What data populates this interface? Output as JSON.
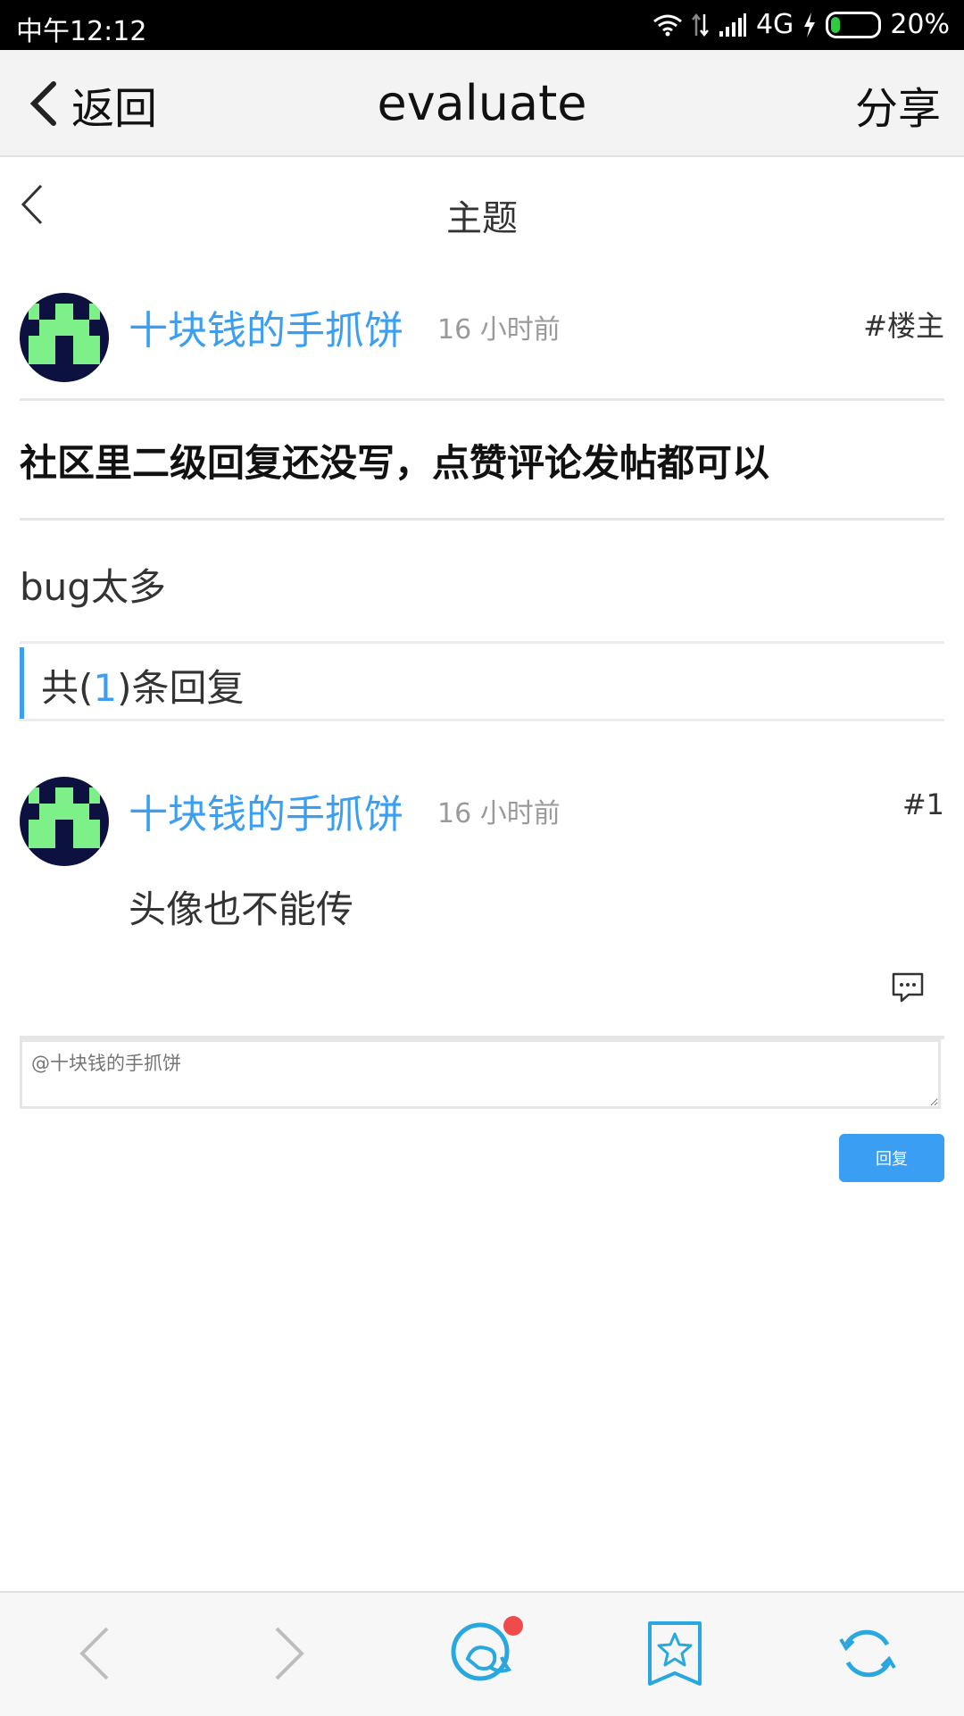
{
  "status_bar": {
    "time": "中午12:12",
    "network": "4G",
    "battery": "20%",
    "battery_level": 0.2,
    "icons": [
      "wifi-icon",
      "data-arrows-icon",
      "signal-icon",
      "charging-icon",
      "battery-icon"
    ]
  },
  "app_bar": {
    "back_label": "返回",
    "title": "evaluate",
    "share_label": "分享"
  },
  "sub_header": {
    "title": "主题"
  },
  "post": {
    "username": "十块钱的手抓饼",
    "time_ago": "16 小时前",
    "floor": "#楼主",
    "title": "社区里二级回复还没写，点赞评论发帖都可以",
    "body": "bug太多"
  },
  "reply_count": {
    "prefix": "共(",
    "count": "1",
    "suffix": ")条回复"
  },
  "comment": {
    "username": "十块钱的手抓饼",
    "time_ago": "16 小时前",
    "floor": "#1",
    "text": "头像也不能传"
  },
  "reply_form": {
    "placeholder": "@十块钱的手抓饼",
    "button_label": "回复"
  },
  "bottom_bar": {
    "items": [
      "back-icon",
      "forward-icon",
      "chat-icon",
      "bookmark-star-icon",
      "refresh-icon"
    ],
    "accent_color": "#29a8e0",
    "badge_color": "#f04b4b"
  },
  "colors": {
    "link": "#3a9ef2",
    "accent": "#3a9ef2"
  }
}
